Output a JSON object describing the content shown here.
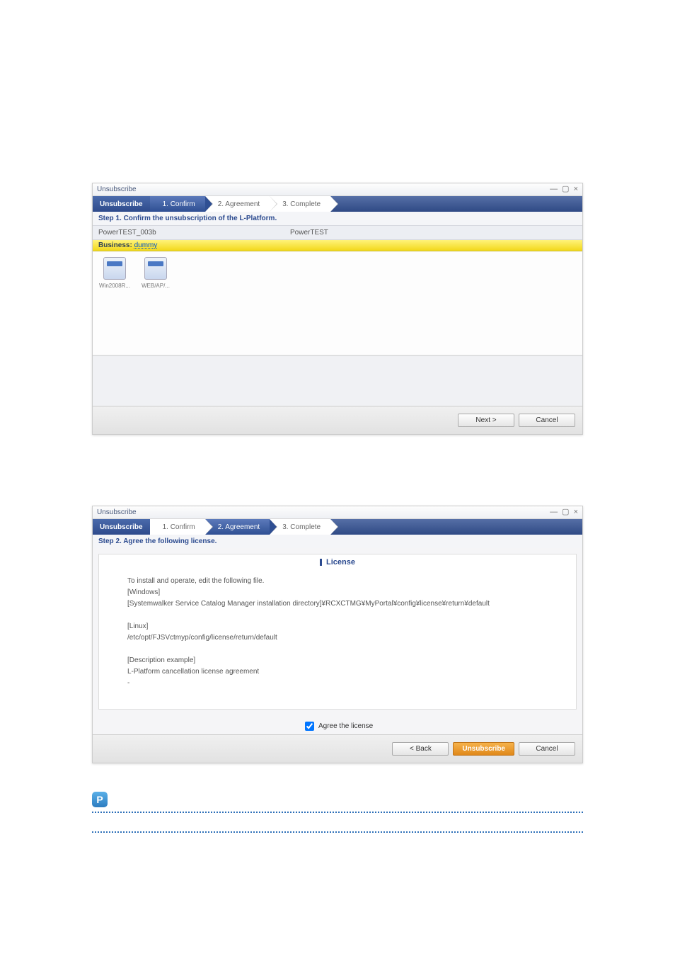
{
  "window1": {
    "title": "Unsubscribe",
    "header_title": "Unsubscribe",
    "steps": {
      "s1": "1. Confirm",
      "s2": "2. Agreement",
      "s3": "3. Complete"
    },
    "instruction": "Step 1. Confirm the unsubscription of the L-Platform.",
    "info": {
      "id": "PowerTEST_003b",
      "name": "PowerTEST"
    },
    "business_label": "Business:",
    "business_value": "dummy",
    "servers": [
      {
        "label": "Win2008R..."
      },
      {
        "label": "WEB/AP/..."
      }
    ],
    "buttons": {
      "next": "Next >",
      "cancel": "Cancel"
    }
  },
  "window2": {
    "title": "Unsubscribe",
    "header_title": "Unsubscribe",
    "steps": {
      "s1": "1. Confirm",
      "s2": "2. Agreement",
      "s3": "3. Complete"
    },
    "instruction": "Step 2. Agree the following license.",
    "license_heading": "License",
    "license_lines": {
      "l1": "To install and operate, edit the following file.",
      "l2": "[Windows]",
      "l3": "[Systemwalker Service Catalog Manager installation directory]¥RCXCTMG¥MyPortal¥config¥license¥return¥default",
      "l4": "[Linux]",
      "l5": "/etc/opt/FJSVctmyp/config/license/return/default",
      "l6": "[Description example]",
      "l7": "L-Platform cancellation license agreement",
      "l8": "-"
    },
    "agree_label": "Agree the license",
    "buttons": {
      "back": "< Back",
      "unsubscribe": "Unsubscribe",
      "cancel": "Cancel"
    }
  },
  "note_icon": "P"
}
